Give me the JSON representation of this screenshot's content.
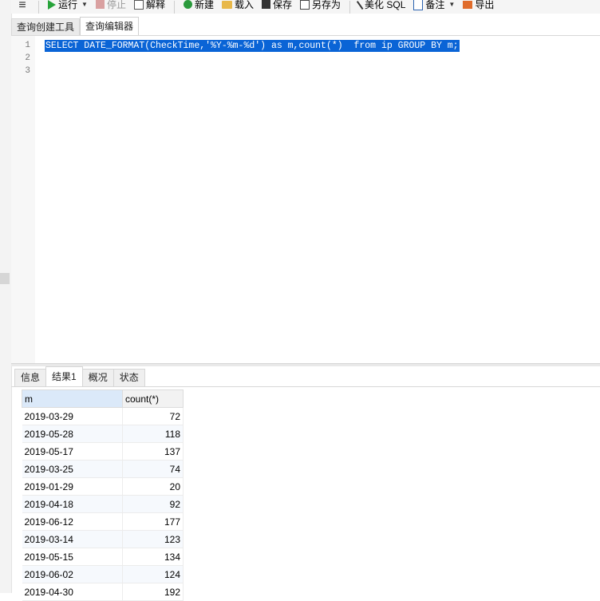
{
  "toolbar": {
    "menu_icon": "hamburger-icon",
    "run": "运行",
    "stop": "停止",
    "explain": "解释",
    "new": "新建",
    "load": "载入",
    "save": "保存",
    "save_as": "另存为",
    "beautify": "美化 SQL",
    "comment": "备注",
    "export": "导出"
  },
  "editor_tabs": [
    "查询创建工具",
    "查询编辑器"
  ],
  "editor": {
    "line_numbers": [
      "1",
      "2",
      "3"
    ],
    "lines": [
      "SELECT DATE_FORMAT(CheckTime,'%Y-%m-%d') as m,count(*)  from ip GROUP BY m;",
      "",
      ""
    ]
  },
  "result_tabs": [
    "信息",
    "结果1",
    "概况",
    "状态"
  ],
  "results": {
    "columns": [
      "m",
      "count(*)"
    ],
    "rows": [
      [
        "2019-03-29",
        "72"
      ],
      [
        "2019-05-28",
        "118"
      ],
      [
        "2019-05-17",
        "137"
      ],
      [
        "2019-03-25",
        "74"
      ],
      [
        "2019-01-29",
        "20"
      ],
      [
        "2019-04-18",
        "92"
      ],
      [
        "2019-06-12",
        "177"
      ],
      [
        "2019-03-14",
        "123"
      ],
      [
        "2019-05-15",
        "134"
      ],
      [
        "2019-06-02",
        "124"
      ],
      [
        "2019-04-30",
        "192"
      ]
    ]
  },
  "colors": {
    "selection": "#0a64d6",
    "run_icon": "#27a33a",
    "header_selected": "#dbe9f9"
  }
}
